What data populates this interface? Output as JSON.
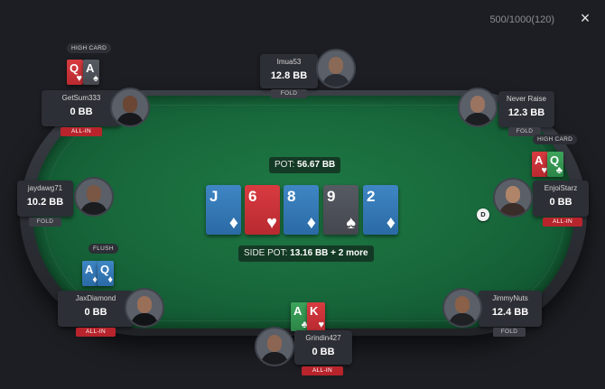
{
  "header": {
    "stakes": "500/1000(120)",
    "close_icon": "×"
  },
  "board": {
    "pot_label": "POT:",
    "pot_value": "56.67 BB",
    "side_pot_label": "SIDE POT:",
    "side_pot_value": "13.16 BB + 2 more",
    "cards": [
      {
        "rank": "J",
        "suit": "♦",
        "color": "blue"
      },
      {
        "rank": "6",
        "suit": "♥",
        "color": "red"
      },
      {
        "rank": "8",
        "suit": "♦",
        "color": "blue"
      },
      {
        "rank": "9",
        "suit": "♠",
        "color": "grey"
      },
      {
        "rank": "2",
        "suit": "♦",
        "color": "blue"
      }
    ]
  },
  "dealer_button": "D",
  "players": {
    "getsum": {
      "name": "GetSum333",
      "stack": "0 BB",
      "status": "ALL-IN",
      "hand": "HIGH CARD",
      "cards": [
        {
          "rank": "Q",
          "suit": "♥"
        },
        {
          "rank": "A",
          "suit": "♠"
        }
      ]
    },
    "imua": {
      "name": "Imua53",
      "stack": "12.8 BB",
      "status": "FOLD"
    },
    "never": {
      "name": "Never Raise",
      "stack": "12.3 BB",
      "status": "FOLD"
    },
    "enjoi": {
      "name": "EnjoiStarz",
      "stack": "0 BB",
      "status": "ALL-IN",
      "hand": "HIGH CARD",
      "cards": [
        {
          "rank": "A",
          "suit": "♥"
        },
        {
          "rank": "Q",
          "suit": "♣"
        }
      ]
    },
    "jaydawg": {
      "name": "jaydawg71",
      "stack": "10.2 BB",
      "status": "FOLD"
    },
    "jax": {
      "name": "JaxDiamond",
      "stack": "0 BB",
      "status": "ALL-IN",
      "hand": "FLUSH",
      "cards": [
        {
          "rank": "A",
          "suit": "♦"
        },
        {
          "rank": "Q",
          "suit": "♦"
        }
      ]
    },
    "jimmy": {
      "name": "JimmyNuts",
      "stack": "12.4 BB",
      "status": "FOLD"
    },
    "grindin": {
      "name": "Grindin427",
      "stack": "0 BB",
      "status": "ALL-IN",
      "cards": [
        {
          "rank": "A",
          "suit": "♣"
        },
        {
          "rank": "K",
          "suit": "♥"
        }
      ]
    }
  },
  "colors": {
    "felt": "#17663a",
    "allin": "#b8242c",
    "card_blue": "#2a6aa5",
    "card_red": "#b82a30",
    "card_green": "#2b8547"
  }
}
